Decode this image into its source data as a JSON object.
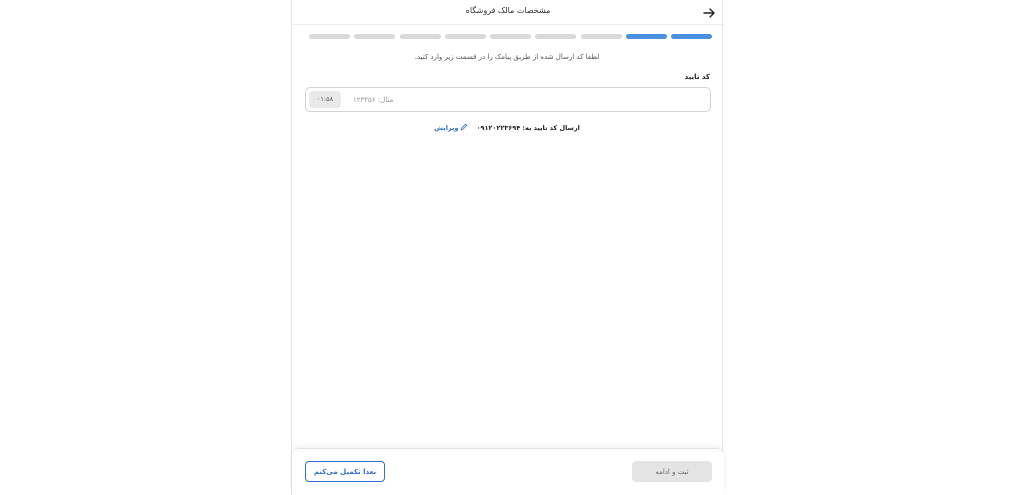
{
  "header": {
    "title": "مشخصات مالک فروشگاه",
    "back_icon": "arrow-right-icon"
  },
  "progress": {
    "total_steps": 9,
    "completed_steps": 2,
    "active_color": "#4a8fe0",
    "inactive_color": "#d9d9d9"
  },
  "verification": {
    "instruction": "لطفا کد ارسال شده از طریق پیامک را در قسمت زیر وارد کنید.",
    "code_label": "کد تایید",
    "code_placeholder": "مثال: ۱۲۳۴۵۶",
    "code_value": "",
    "timer": "۰۱:۵۸",
    "sent_to_label": "ارسال کد تایید به: ۰۹۱۲۰۲۲۳۶۹۴",
    "edit_label": "ویرایش",
    "edit_icon": "pencil-icon"
  },
  "footer": {
    "later_button": "بعدا تکمیل می‌کنم",
    "submit_button": "ثبت و ادامه"
  },
  "colors": {
    "accent": "#2f6fd1",
    "disabled_button": "#e4e4e4"
  }
}
